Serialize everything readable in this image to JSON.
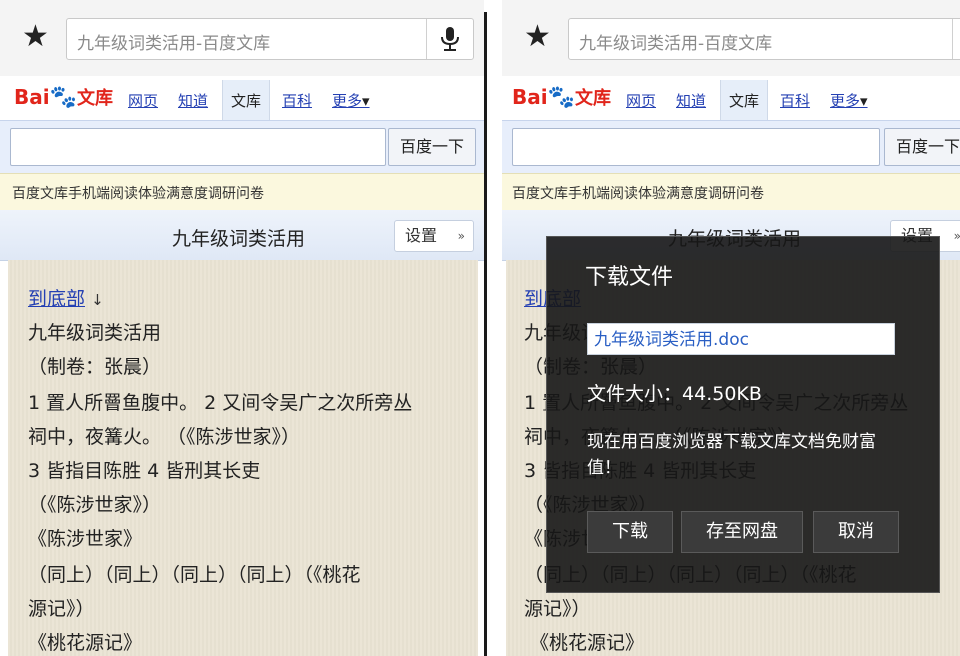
{
  "browser": {
    "url_text": "九年级词类活用-百度文库"
  },
  "nav": {
    "logo_bai": "Bai",
    "logo_paw": "🐾",
    "logo_wenku": "文库",
    "items": [
      "网页",
      "知道",
      "文库",
      "百科",
      "更多"
    ],
    "more_arrow": "▾"
  },
  "search": {
    "button_label": "百度一下"
  },
  "notice": "百度文库手机端阅读体验满意度调研问卷",
  "doc": {
    "title": "九年级词类活用",
    "settings_label": "设置",
    "settings_chevron": "»",
    "lines": [
      "九年级词类活用",
      "（制卷：张晨）",
      "1 置人所罾鱼腹中。 2 又间令吴广之次所旁丛",
      "祠中，夜篝火。 （《陈涉世家》）",
      "3 皆指目陈胜 4 皆刑其长吏",
      "（《陈涉世家》）",
      "《陈涉世家》",
      "（同上）（同上）（同上）（同上）（《桃花",
      "源记》）",
      "《桃花源记》"
    ],
    "to_bottom_link": "到底部",
    "to_bottom_arrow": "↓"
  },
  "dialog": {
    "title": "下载文件",
    "filename": "九年级词类活用.doc",
    "size_label": "文件大小：",
    "size_value": "44.50KB",
    "message": "现在用百度浏览器下载文库文档免财富值！",
    "buttons": [
      "下载",
      "存至网盘",
      "取消"
    ]
  },
  "colors": {
    "link": "#2440b3",
    "logo_red": "#e1251b",
    "logo_blue": "#2b4fd6",
    "dialog_bg": "#161616",
    "content_bg": "#eae4d4",
    "notice_bg": "#fbf8de"
  }
}
